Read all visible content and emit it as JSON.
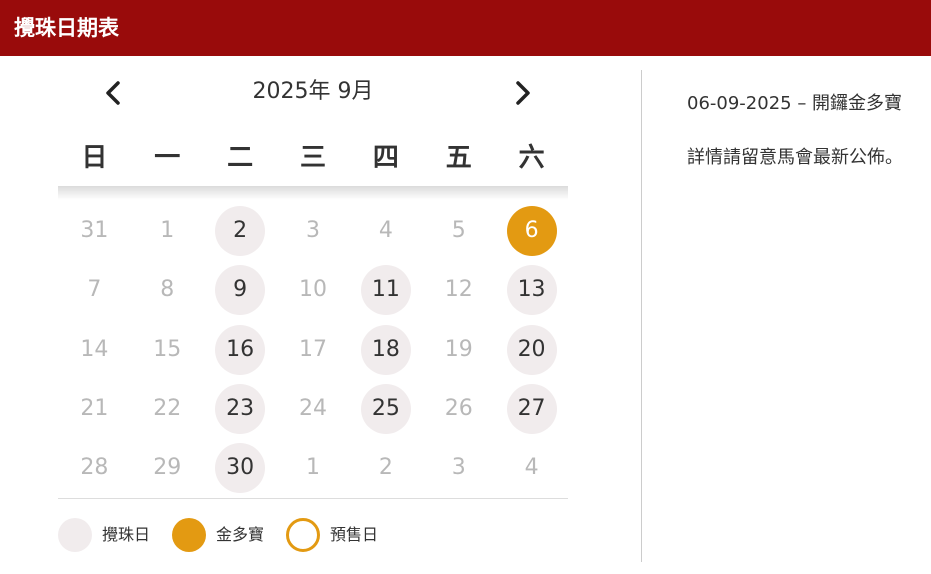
{
  "header": {
    "title": "攪珠日期表"
  },
  "calendar": {
    "month_label": "2025年 9月",
    "prev_icon": "chevron-left-icon",
    "next_icon": "chevron-right-icon",
    "weekdays": [
      "日",
      "一",
      "二",
      "三",
      "四",
      "五",
      "六"
    ],
    "weeks": [
      [
        {
          "day": "31",
          "type": "inactive"
        },
        {
          "day": "1",
          "type": "inactive"
        },
        {
          "day": "2",
          "type": "draw"
        },
        {
          "day": "3",
          "type": "inactive"
        },
        {
          "day": "4",
          "type": "inactive"
        },
        {
          "day": "5",
          "type": "inactive"
        },
        {
          "day": "6",
          "type": "jackpot"
        }
      ],
      [
        {
          "day": "7",
          "type": "inactive"
        },
        {
          "day": "8",
          "type": "inactive"
        },
        {
          "day": "9",
          "type": "draw"
        },
        {
          "day": "10",
          "type": "inactive"
        },
        {
          "day": "11",
          "type": "draw"
        },
        {
          "day": "12",
          "type": "inactive"
        },
        {
          "day": "13",
          "type": "draw"
        }
      ],
      [
        {
          "day": "14",
          "type": "inactive"
        },
        {
          "day": "15",
          "type": "inactive"
        },
        {
          "day": "16",
          "type": "draw"
        },
        {
          "day": "17",
          "type": "inactive"
        },
        {
          "day": "18",
          "type": "draw"
        },
        {
          "day": "19",
          "type": "inactive"
        },
        {
          "day": "20",
          "type": "draw"
        }
      ],
      [
        {
          "day": "21",
          "type": "inactive"
        },
        {
          "day": "22",
          "type": "inactive"
        },
        {
          "day": "23",
          "type": "draw"
        },
        {
          "day": "24",
          "type": "inactive"
        },
        {
          "day": "25",
          "type": "draw"
        },
        {
          "day": "26",
          "type": "inactive"
        },
        {
          "day": "27",
          "type": "draw"
        }
      ],
      [
        {
          "day": "28",
          "type": "inactive"
        },
        {
          "day": "29",
          "type": "inactive"
        },
        {
          "day": "30",
          "type": "draw"
        },
        {
          "day": "1",
          "type": "inactive"
        },
        {
          "day": "2",
          "type": "inactive"
        },
        {
          "day": "3",
          "type": "inactive"
        },
        {
          "day": "4",
          "type": "inactive"
        }
      ]
    ]
  },
  "legend": [
    {
      "label": "攪珠日",
      "style": "draw"
    },
    {
      "label": "金多寶",
      "style": "jackpot"
    },
    {
      "label": "預售日",
      "style": "presale"
    }
  ],
  "info": {
    "title": "06-09-2025 – 開鑼金多寶",
    "note": "詳情請留意馬會最新公佈。"
  },
  "colors": {
    "header_bg": "#990b0b",
    "jackpot": "#e39a12",
    "draw_day_bg": "#f1eced",
    "inactive_text": "#b8b8b8"
  }
}
